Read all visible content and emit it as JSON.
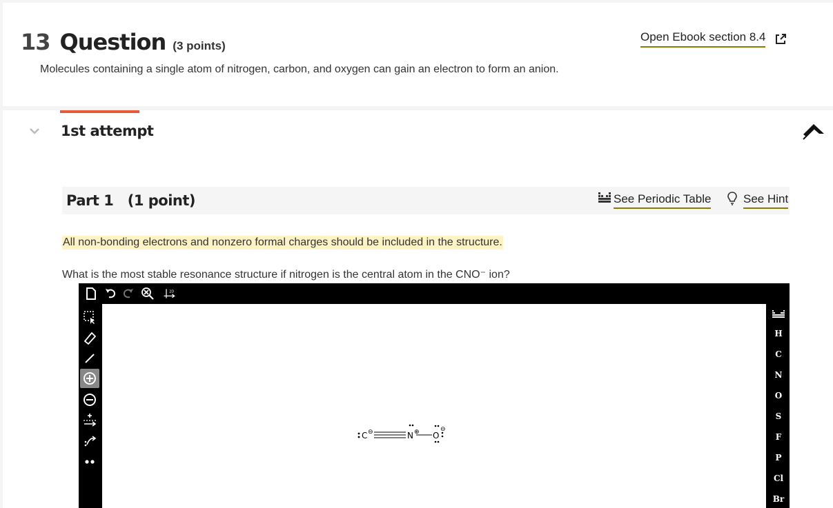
{
  "question": {
    "number": "13",
    "word": "Question",
    "points": "(3 points)",
    "description": "Molecules containing a single atom of nitrogen, carbon, and oxygen can gain an electron to form an anion.",
    "ebook_link": "Open Ebook section 8.4"
  },
  "attempt": {
    "label": "1st attempt"
  },
  "part": {
    "title": "Part 1   (1 point)",
    "periodic_link": "See Periodic Table",
    "hint_link": "See Hint"
  },
  "instruction": "All non-bonding electrons and nonzero formal charges should be included in the structure.",
  "question_text": "What is the most stable resonance structure if nitrogen is the central atom in the CNO⁻ ion?",
  "editor": {
    "elements": [
      "H",
      "C",
      "N",
      "O",
      "S",
      "F",
      "P",
      "Cl",
      "Br"
    ],
    "molecule": {
      "atoms": [
        "C",
        "N",
        "O"
      ],
      "charge_minus": "⊖",
      "charge_plus": "⊕"
    }
  },
  "colors": {
    "accent_bar": "#e65a3a",
    "link_underline": "#8a7a00",
    "highlight": "#fdf3c4"
  }
}
